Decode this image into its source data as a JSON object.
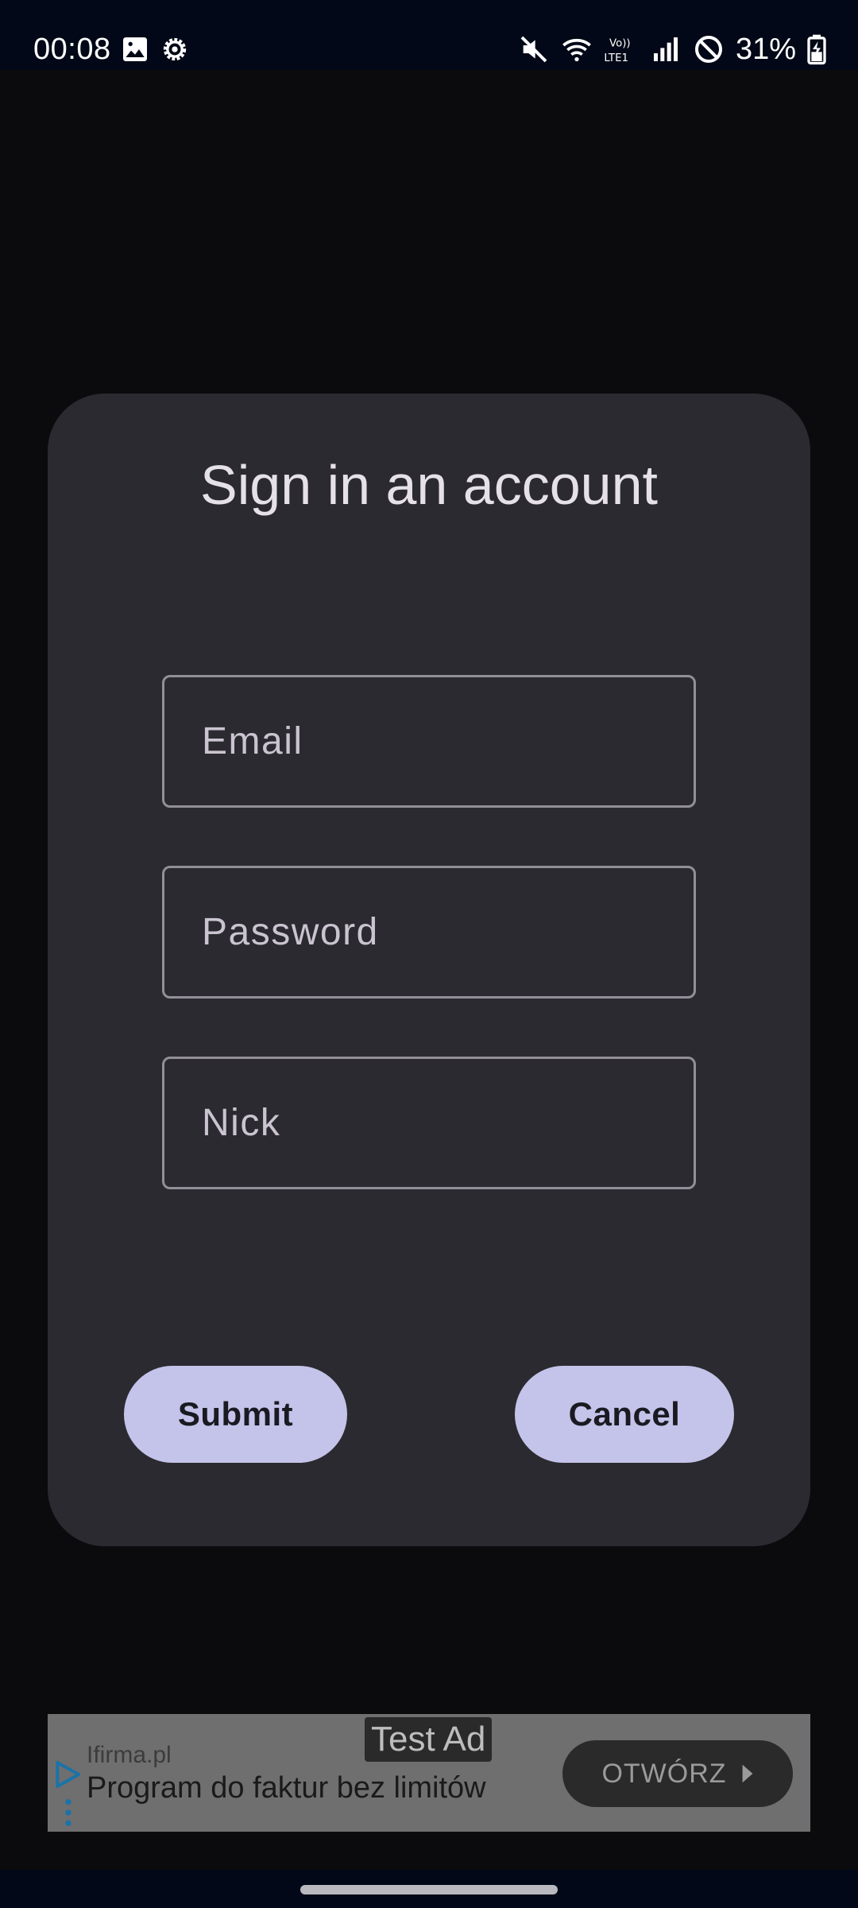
{
  "status_bar": {
    "time": "00:08",
    "battery": "31%",
    "network_label": "LTE1",
    "volte_label": "Vo))",
    "left_icons": [
      "gallery-icon",
      "settings-gear-icon"
    ],
    "right_icons": [
      "mute-icon",
      "wifi-icon",
      "volte-lte-icon",
      "signal-icon",
      "do-not-disturb-icon",
      "battery-charging-icon"
    ]
  },
  "dialog": {
    "title": "Sign in an account",
    "email_placeholder": "Email",
    "password_placeholder": "Password",
    "nick_placeholder": "Nick",
    "submit_label": "Submit",
    "cancel_label": "Cancel"
  },
  "ad": {
    "badge": "Test Ad",
    "advertiser": "Ifirma.pl",
    "headline": "Program do faktur bez limitów",
    "cta": "OTWÓRZ"
  },
  "colors": {
    "background": "#0b0b0d",
    "dialog": "#2b2a30",
    "button": "#c4c4ea",
    "field_border": "#938f99",
    "status_bar": "#020817"
  }
}
